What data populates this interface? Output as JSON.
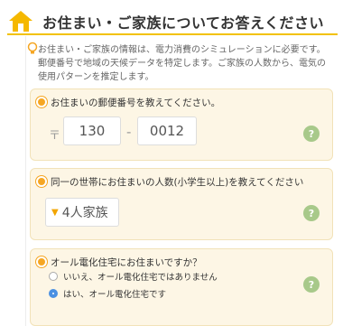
{
  "header": {
    "title": "お住まい・ご家族についてお答えください",
    "icon": "house-icon",
    "accent_color": "#f2c100"
  },
  "info": {
    "icon": "lightbulb-icon",
    "text": "お住まい・ご家族の情報は、電力消費のシミュレーションに必要です。郵便番号で地域の天候データを特定します。ご家族の人数から、電気の使用パターンを推定します。"
  },
  "questions": {
    "postal": {
      "label": "お住まいの郵便番号を教えてください。",
      "mark": "〒",
      "first_value": "130",
      "dash": "-",
      "second_value": "0012",
      "help": "?"
    },
    "household": {
      "label": "同一の世帯にお住まいの人数(小学生以上)を教えてください",
      "caret": "▼",
      "selected": "4人家族",
      "help": "?"
    },
    "all_electric": {
      "label": "オール電化住宅にお住まいですか？",
      "options": [
        {
          "label": "いいえ、オール電化住宅ではありません",
          "checked": false
        },
        {
          "label": "はい、オール電化住宅です",
          "checked": true
        }
      ],
      "help": "?"
    }
  }
}
